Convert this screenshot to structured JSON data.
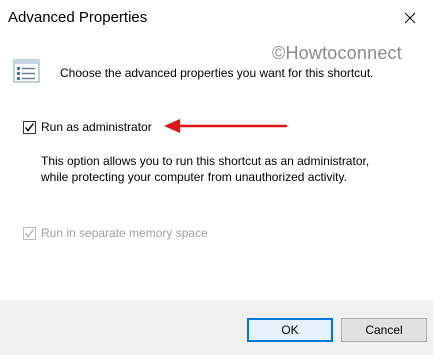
{
  "window": {
    "title": "Advanced Properties",
    "close_icon": "close-icon"
  },
  "watermark": "©Howtoconnect",
  "intro": {
    "icon": "properties-list-icon",
    "text": "Choose the advanced properties you want for this shortcut."
  },
  "options": {
    "run_as_admin": {
      "label": "Run as administrator",
      "checked": true,
      "enabled": true
    },
    "description": "This option allows you to run this shortcut as an administrator, while protecting your computer from unauthorized activity.",
    "separate_memory": {
      "label": "Run in separate memory space",
      "checked": true,
      "enabled": false
    }
  },
  "annotation": {
    "arrow_color": "#e0131a"
  },
  "buttons": {
    "ok": "OK",
    "cancel": "Cancel"
  },
  "colors": {
    "accent": "#0078d7",
    "footer_bg": "#f0f0f0",
    "disabled_text": "#a0a0a0"
  }
}
